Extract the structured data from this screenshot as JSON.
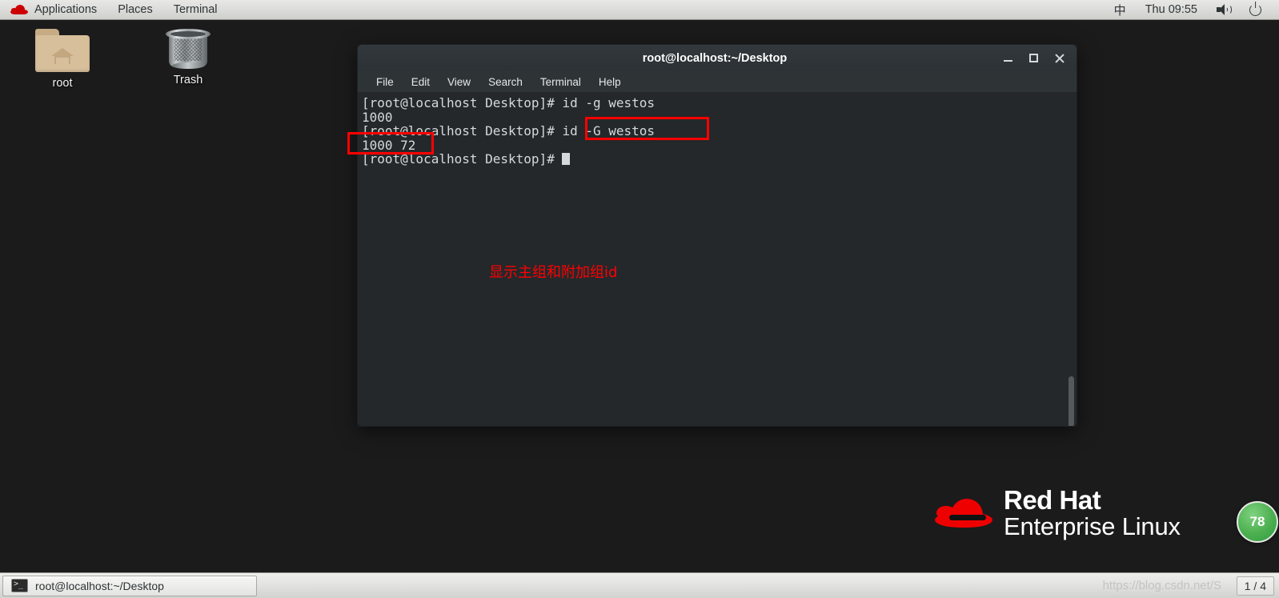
{
  "top_panel": {
    "logo_icon": "redhat-icon",
    "menus": [
      {
        "label": "Applications"
      },
      {
        "label": "Places"
      },
      {
        "label": "Terminal"
      }
    ],
    "ime_indicator": "中",
    "clock": "Thu 09:55",
    "volume_icon": "speaker-icon",
    "power_icon": "power-icon"
  },
  "desktop": {
    "background_color": "#1b1b1b",
    "icons": [
      {
        "label": "root",
        "icon": "home-folder-icon"
      },
      {
        "label": "Trash",
        "icon": "trash-can-icon"
      }
    ],
    "branding": {
      "line1": "Red Hat",
      "line2": "Enterprise Linux",
      "logo_icon": "redhat-fedora-icon",
      "color": "#ee0000"
    },
    "badge": {
      "text": "78",
      "color": "#4caf50"
    }
  },
  "terminal": {
    "title": "root@localhost:~/Desktop",
    "background_color": "#24282b",
    "text_color": "#d6d9db",
    "window_buttons": {
      "minimize": "minimize-icon",
      "maximize": "maximize-icon",
      "close": "close-icon"
    },
    "menu": [
      {
        "label": "File"
      },
      {
        "label": "Edit"
      },
      {
        "label": "View"
      },
      {
        "label": "Search"
      },
      {
        "label": "Terminal"
      },
      {
        "label": "Help"
      }
    ],
    "lines": [
      "[root@localhost Desktop]# id -g westos",
      "1000",
      "[root@localhost Desktop]# id -G westos",
      "1000 72",
      "[root@localhost Desktop]# "
    ],
    "prompt": "[root@localhost Desktop]# ",
    "content": "[root@localhost Desktop]# id -g westos\n1000\n[root@localhost Desktop]# id -G westos\n1000 72\n[root@localhost Desktop]# "
  },
  "annotations": {
    "color": "#ff0000",
    "note_text": "显示主组和附加组id",
    "highlighted_command": "id -G westos",
    "highlighted_output": "1000 72"
  },
  "bottom_panel": {
    "task_label": "root@localhost:~/Desktop",
    "task_icon": "terminal-icon",
    "watermark": "https://blog.csdn.net/S",
    "workspace": "1 / 4"
  }
}
